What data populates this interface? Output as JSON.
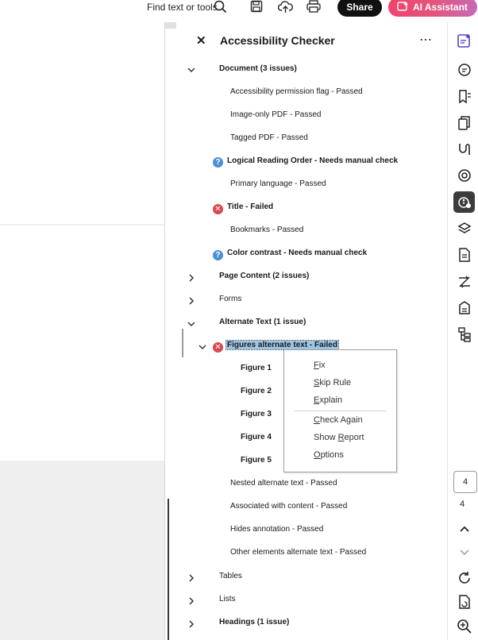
{
  "toolbar": {
    "find_label": "Find text or tools",
    "share_label": "Share",
    "ai_label": "AI Assistant"
  },
  "panel": {
    "title": "Accessibility Checker",
    "sections": {
      "document": {
        "label": "Document (3 issues)",
        "items": [
          "Accessibility permission flag - Passed",
          "Image-only PDF - Passed",
          "Tagged PDF - Passed",
          "Logical Reading Order - Needs manual check",
          "Primary language - Passed",
          "Title - Failed",
          "Bookmarks - Passed",
          "Color contrast - Needs manual check"
        ]
      },
      "page_content": {
        "label": "Page Content (2 issues)"
      },
      "forms": {
        "label": "Forms"
      },
      "alternate_text": {
        "label": "Alternate Text (1 issue)",
        "figures_rule": "Figures alternate text - Failed",
        "figures": [
          "Figure 1",
          "Figure 2",
          "Figure 3",
          "Figure 4",
          "Figure 5"
        ],
        "items": [
          "Nested alternate text - Passed",
          "Associated with content - Passed",
          "Hides annotation - Passed",
          "Other elements alternate text - Passed"
        ]
      },
      "tables": {
        "label": "Tables"
      },
      "lists": {
        "label": "Lists"
      },
      "headings": {
        "label": "Headings (1 issue)"
      }
    }
  },
  "context_menu": {
    "fix": "Fix",
    "skip_rule": "Skip Rule",
    "explain": "Explain",
    "check_again": "Check Again",
    "show_report": "Show Report",
    "options": "Options"
  },
  "pager": {
    "current_page": "4",
    "total_pages": "4"
  },
  "colors": {
    "accent": "#5a3fd6",
    "selection": "#9cc6e8",
    "failed": "#d9474f",
    "manual": "#4b8fd6"
  }
}
